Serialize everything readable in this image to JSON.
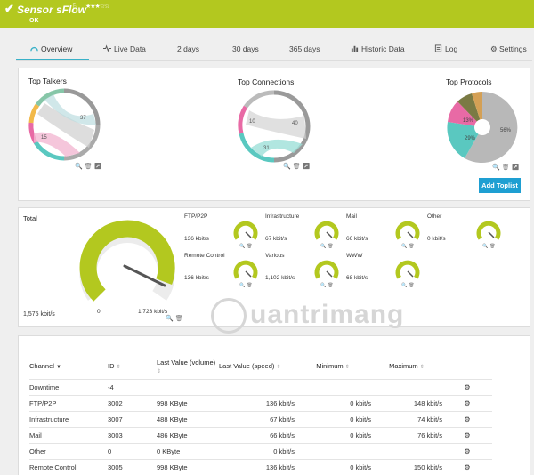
{
  "header": {
    "title": "Sensor sFlow",
    "status": "OK",
    "stars": "★★★☆☆"
  },
  "tabs": [
    {
      "label": "Overview"
    },
    {
      "label": "Live Data"
    },
    {
      "label": "2  days"
    },
    {
      "label": "30  days"
    },
    {
      "label": "365  days"
    },
    {
      "label": "Historic Data"
    },
    {
      "label": "Log"
    },
    {
      "label": "Settings"
    }
  ],
  "toplists": {
    "talkers": {
      "title": "Top Talkers",
      "labels": [
        "37",
        "15"
      ]
    },
    "connections": {
      "title": "Top Connections",
      "labels": [
        "10",
        "40",
        "31"
      ]
    },
    "protocols": {
      "title": "Top Protocols",
      "labels": [
        "13%",
        "29%",
        "56%"
      ]
    },
    "add_button": "Add Toplist"
  },
  "total": {
    "title": "Total",
    "value": "1,575 kbit/s",
    "min": "0",
    "max": "1,723 kbit/s",
    "level": 0.91
  },
  "small_gauges": [
    {
      "label": "FTP/P2P",
      "value": "136 kbit/s"
    },
    {
      "label": "Infrastructure",
      "value": "67 kbit/s"
    },
    {
      "label": "Mail",
      "value": "66 kbit/s"
    },
    {
      "label": "Other",
      "value": "0 kbit/s"
    },
    {
      "label": "Remote Control",
      "value": "136 kbit/s"
    },
    {
      "label": "Various",
      "value": "1,102 kbit/s"
    },
    {
      "label": "WWW",
      "value": "68 kbit/s"
    }
  ],
  "watermark": "uantrimang",
  "table": {
    "headers": [
      "Channel",
      "ID",
      "Last Value (volume)",
      "Last Value (speed)",
      "Minimum",
      "Maximum"
    ],
    "rows": [
      [
        "Downtime",
        "-4",
        "",
        "",
        "",
        ""
      ],
      [
        "FTP/P2P",
        "3002",
        "998 KByte",
        "136 kbit/s",
        "0 kbit/s",
        "148 kbit/s"
      ],
      [
        "Infrastructure",
        "3007",
        "488 KByte",
        "67 kbit/s",
        "0 kbit/s",
        "74 kbit/s"
      ],
      [
        "Mail",
        "3003",
        "486 KByte",
        "66 kbit/s",
        "0 kbit/s",
        "76 kbit/s"
      ],
      [
        "Other",
        "0",
        "0 KByte",
        "0 kbit/s",
        "",
        ""
      ],
      [
        "Remote Control",
        "3005",
        "998 KByte",
        "136 kbit/s",
        "0 kbit/s",
        "150 kbit/s"
      ]
    ]
  },
  "colors": {
    "header": "#b3c81f",
    "gauge": "#b3c81f",
    "accent": "#39b1c8",
    "button": "#1e9fd2"
  }
}
